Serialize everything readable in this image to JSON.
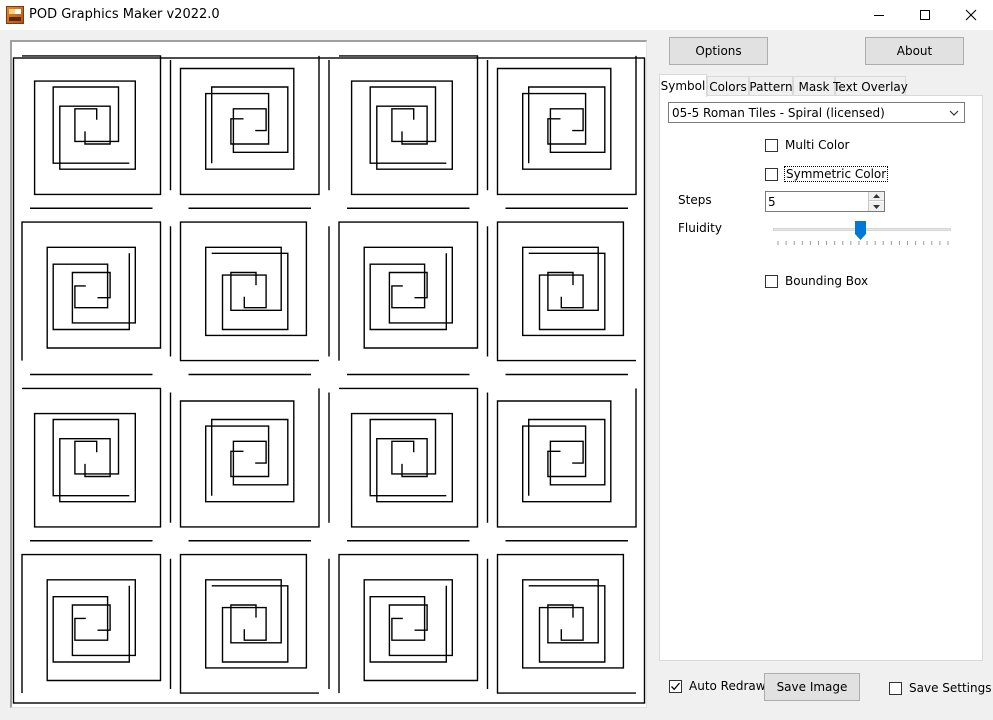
{
  "window": {
    "title": "POD Graphics Maker v2022.0",
    "icon": "app-logo-icon",
    "controls": [
      "minimize-icon",
      "maximize-icon",
      "close-icon"
    ]
  },
  "toolbar": {
    "options_label": "Options",
    "about_label": "About"
  },
  "tabs": [
    {
      "label": "Symbol",
      "active": true
    },
    {
      "label": "Colors",
      "active": false
    },
    {
      "label": "Pattern",
      "active": false
    },
    {
      "label": "Mask",
      "active": false
    },
    {
      "label": "Text Overlay",
      "active": false
    }
  ],
  "symbol_panel": {
    "symbol_select": {
      "selected": "05-5 Roman Tiles - Spiral (licensed)"
    },
    "multi_color": {
      "label": "Multi Color",
      "checked": false
    },
    "symmetric_color": {
      "label": "Symmetric Color",
      "checked": false
    },
    "steps": {
      "label": "Steps",
      "value": "5"
    },
    "fluidity": {
      "label": "Fluidity",
      "value_fraction": 0.49,
      "tick_count": 22
    },
    "bounding_box": {
      "label": "Bounding Box",
      "checked": false
    }
  },
  "footer": {
    "auto_redraw": {
      "label": "Auto Redraw",
      "checked": true
    },
    "save_image_label": "Save Image",
    "save_settings": {
      "label": "Save Settings",
      "checked": false
    }
  },
  "colors": {
    "accent": "#0078d7",
    "line": "#000000",
    "canvas_bg": "#ffffff"
  }
}
